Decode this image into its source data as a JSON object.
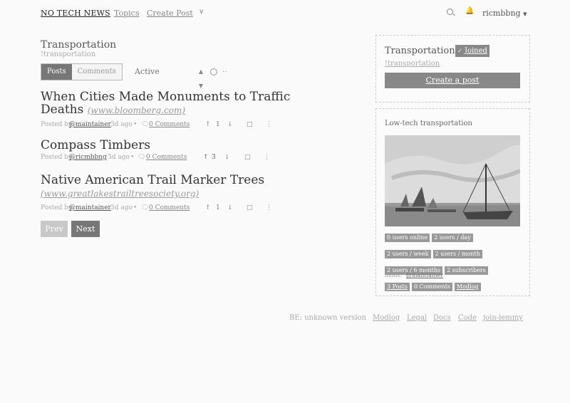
{
  "nav": {
    "brand": "NO TECH NEWS",
    "links": [
      "Topics",
      "Create Post"
    ],
    "username": "ricmbbng"
  },
  "community": {
    "title": "Transportation",
    "slug": "!transportation",
    "toggle": [
      "Posts",
      "Comments"
    ],
    "sort": "Active"
  },
  "posts": [
    {
      "title": "When Cities Made Monuments to Traffic Deaths",
      "domain": "(www.bloomberg.com)",
      "posted_by": "Posted by",
      "author": "@maintainer",
      "age": "3d ago",
      "comments": "0 Comments",
      "score": "1"
    },
    {
      "title": "Compass Timbers",
      "domain": "",
      "posted_by": "Posted by",
      "author": "@ricmbbng",
      "age": "3d ago",
      "comments": "0 Comments",
      "score": "3"
    },
    {
      "title": "Native American Trail Marker Trees",
      "domain": "(www.greatlakestrailtreesociety.org)",
      "posted_by": "Posted by",
      "author": "@maintainer",
      "age": "3d ago",
      "comments": "0 Comments",
      "score": "1"
    }
  ],
  "pager": {
    "prev": "Prev",
    "next": "Next"
  },
  "sidebar": {
    "title": "Transportation",
    "joined": "Joined",
    "slug": "!transportation",
    "create_post": "Create a post",
    "description": "Low-tech transportation",
    "stats": [
      "0 users online",
      "2 users / day",
      "2 users / week",
      "2 users / month",
      "2 users / 6 months",
      "2 subscribers",
      "3 Posts",
      "0 Comments",
      "Modlog"
    ],
    "mods_label": "mods:",
    "mod": "@maintainer"
  },
  "footer": {
    "version": "BE: unknown version",
    "links": [
      "Modlog",
      "Legal",
      "Docs",
      "Code",
      "join-lemmy"
    ]
  },
  "colors": {
    "accent_button": "#888888",
    "rule": "#555555",
    "background": "#fafafa"
  }
}
